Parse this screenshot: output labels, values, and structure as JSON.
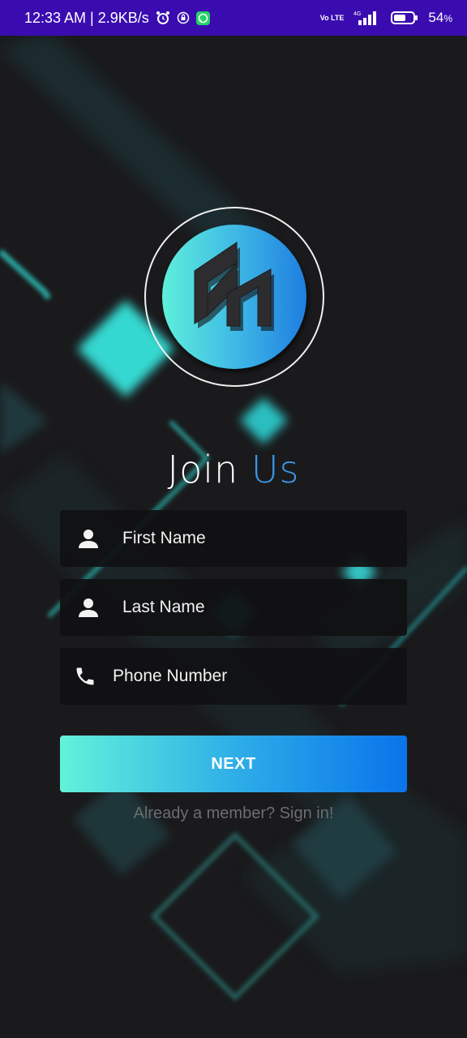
{
  "status_bar": {
    "time_speed": "12:33 AM | 2.9KB/s",
    "network_label": "Vo LTE",
    "network_gen": "4G",
    "battery": "54",
    "battery_unit": "%"
  },
  "header": {
    "title_word1": "Join",
    "title_word2": "Us"
  },
  "form": {
    "first_name": "First Name",
    "last_name": "Last Name",
    "phone": "Phone Number"
  },
  "actions": {
    "next_label": "NEXT",
    "signin_link": "Already a member? Sign in!"
  },
  "colors": {
    "status_bar": "#3a0cb0",
    "background": "#1a1a1c",
    "accent_blue": "#3c98e8",
    "accent_teal": "#5ef0dc"
  },
  "icons": [
    "alarm-icon",
    "location-lock-icon",
    "whatsapp-icon",
    "signal-icon",
    "battery-icon",
    "person-icon",
    "phone-icon"
  ]
}
